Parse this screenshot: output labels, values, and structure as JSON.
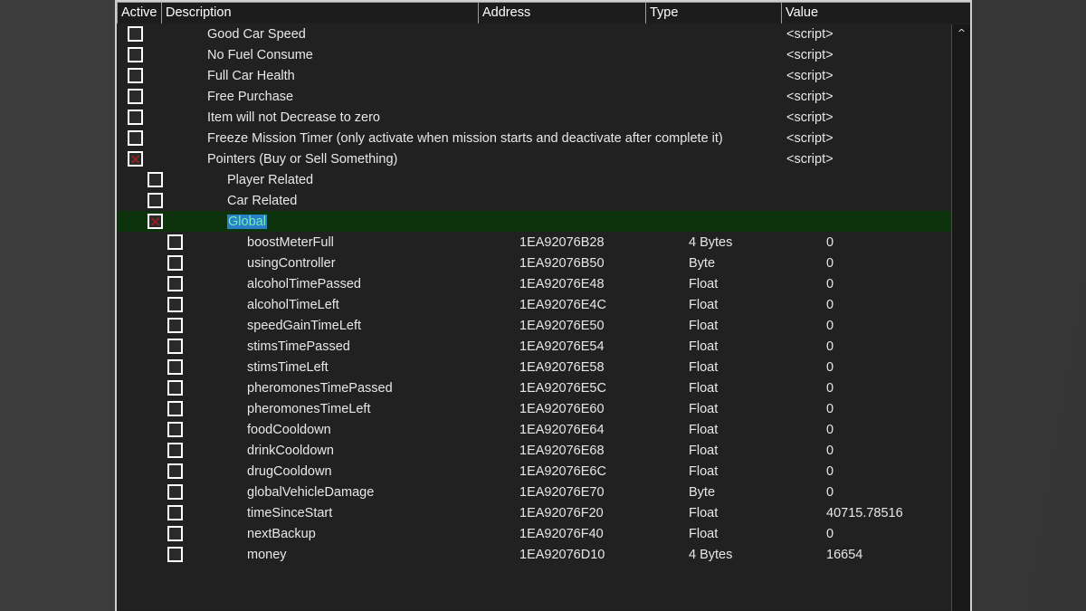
{
  "panel": {
    "columns": [
      {
        "key": "active",
        "label": "Active"
      },
      {
        "key": "description",
        "label": "Description"
      },
      {
        "key": "address",
        "label": "Address"
      },
      {
        "key": "type",
        "label": "Type"
      },
      {
        "key": "value",
        "label": "Value"
      }
    ],
    "scrollbar": {
      "up_arrow": "^"
    },
    "colors": {
      "panel_background": "#212121",
      "selected_row": "#0c330c",
      "selection_highlight": "#2b7ec8",
      "selection_text": "#6ff0b8",
      "checkbox_x": "#8c2222",
      "text": "#e8e8e8",
      "border": "#cfcfcf"
    },
    "rows": [
      {
        "indent": 0,
        "checked": false,
        "description": "Good Car Speed",
        "address": "",
        "type": "",
        "value": "<script>",
        "selected": false
      },
      {
        "indent": 0,
        "checked": false,
        "description": "No Fuel Consume",
        "address": "",
        "type": "",
        "value": "<script>",
        "selected": false
      },
      {
        "indent": 0,
        "checked": false,
        "description": "Full Car Health",
        "address": "",
        "type": "",
        "value": "<script>",
        "selected": false
      },
      {
        "indent": 0,
        "checked": false,
        "description": "Free Purchase",
        "address": "",
        "type": "",
        "value": "<script>",
        "selected": false
      },
      {
        "indent": 0,
        "checked": false,
        "description": "Item will not Decrease to zero",
        "address": "",
        "type": "",
        "value": "<script>",
        "selected": false
      },
      {
        "indent": 0,
        "checked": false,
        "description": "Freeze Mission Timer (only activate when mission starts and deactivate after complete it)",
        "address": "",
        "type": "",
        "value": "<script>",
        "selected": false
      },
      {
        "indent": 0,
        "checked": true,
        "description": "Pointers (Buy or Sell Something)",
        "address": "",
        "type": "",
        "value": "<script>",
        "selected": false
      },
      {
        "indent": 1,
        "checked": false,
        "description": "Player Related",
        "address": "",
        "type": "",
        "value": "",
        "selected": false
      },
      {
        "indent": 1,
        "checked": false,
        "description": "Car Related",
        "address": "",
        "type": "",
        "value": "",
        "selected": false
      },
      {
        "indent": 1,
        "checked": true,
        "description": "Global",
        "address": "",
        "type": "",
        "value": "",
        "selected": true
      },
      {
        "indent": 2,
        "checked": false,
        "description": "boostMeterFull",
        "address": "1EA92076B28",
        "type": "4 Bytes",
        "value": "0",
        "selected": false
      },
      {
        "indent": 2,
        "checked": false,
        "description": "usingController",
        "address": "1EA92076B50",
        "type": "Byte",
        "value": "0",
        "selected": false
      },
      {
        "indent": 2,
        "checked": false,
        "description": "alcoholTimePassed",
        "address": "1EA92076E48",
        "type": "Float",
        "value": "0",
        "selected": false
      },
      {
        "indent": 2,
        "checked": false,
        "description": "alcoholTimeLeft",
        "address": "1EA92076E4C",
        "type": "Float",
        "value": "0",
        "selected": false
      },
      {
        "indent": 2,
        "checked": false,
        "description": "speedGainTimeLeft",
        "address": "1EA92076E50",
        "type": "Float",
        "value": "0",
        "selected": false
      },
      {
        "indent": 2,
        "checked": false,
        "description": "stimsTimePassed",
        "address": "1EA92076E54",
        "type": "Float",
        "value": "0",
        "selected": false
      },
      {
        "indent": 2,
        "checked": false,
        "description": "stimsTimeLeft",
        "address": "1EA92076E58",
        "type": "Float",
        "value": "0",
        "selected": false
      },
      {
        "indent": 2,
        "checked": false,
        "description": "pheromonesTimePassed",
        "address": "1EA92076E5C",
        "type": "Float",
        "value": "0",
        "selected": false
      },
      {
        "indent": 2,
        "checked": false,
        "description": "pheromonesTimeLeft",
        "address": "1EA92076E60",
        "type": "Float",
        "value": "0",
        "selected": false
      },
      {
        "indent": 2,
        "checked": false,
        "description": "foodCooldown",
        "address": "1EA92076E64",
        "type": "Float",
        "value": "0",
        "selected": false
      },
      {
        "indent": 2,
        "checked": false,
        "description": "drinkCooldown",
        "address": "1EA92076E68",
        "type": "Float",
        "value": "0",
        "selected": false
      },
      {
        "indent": 2,
        "checked": false,
        "description": "drugCooldown",
        "address": "1EA92076E6C",
        "type": "Float",
        "value": "0",
        "selected": false
      },
      {
        "indent": 2,
        "checked": false,
        "description": "globalVehicleDamage",
        "address": "1EA92076E70",
        "type": "Byte",
        "value": "0",
        "selected": false
      },
      {
        "indent": 2,
        "checked": false,
        "description": "timeSinceStart",
        "address": "1EA92076F20",
        "type": "Float",
        "value": "40715.78516",
        "selected": false
      },
      {
        "indent": 2,
        "checked": false,
        "description": "nextBackup",
        "address": "1EA92076F40",
        "type": "Float",
        "value": "0",
        "selected": false
      },
      {
        "indent": 2,
        "checked": false,
        "description": "money",
        "address": "1EA92076D10",
        "type": "4 Bytes",
        "value": "16654",
        "selected": false
      }
    ]
  }
}
